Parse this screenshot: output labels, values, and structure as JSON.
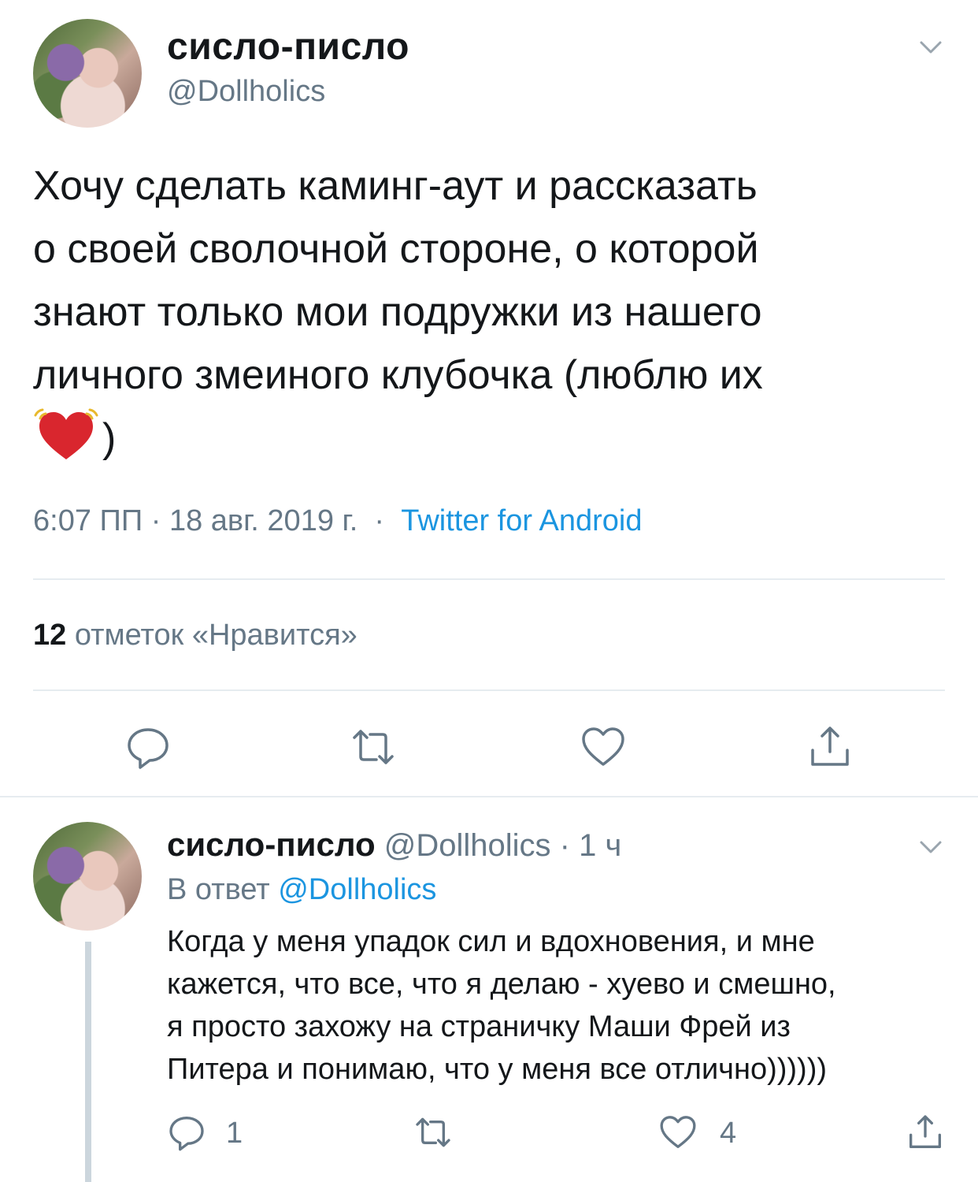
{
  "main_tweet": {
    "display_name": "сисло-писло",
    "handle": "@Dollhoics",
    "text_lines": [
      "Хочу сделать каминг-аут и рассказать",
      "о своей сволочной стороне, о которой",
      "знают только мои подружки из нашего",
      "личного змеиного клубочка (люблю их",
      ")"
    ],
    "time": "6:07 ПП",
    "date": "18 авг. 2019 г.",
    "separator": "·",
    "source": "Twitter for Android",
    "likes_count": "12",
    "likes_label": "отметок «Нравится»",
    "emoji": "vibrating-heart"
  },
  "reply_tweet": {
    "display_name": "сисло-писло",
    "handle": "@Dollholics",
    "time_ago": "· 1 ч",
    "reply_prefix": "В ответ",
    "reply_mention": "@Dollholics",
    "text_lines": [
      "Когда у меня упадок сил и вдохновения, и мне",
      "кажется, что все, что я делаю - хуево и смешно,",
      "я просто захожу на страничку Маши Фрей из",
      "Питера и понимаю, что у меня все отлично))))))"
    ],
    "reply_count": "1",
    "like_count": "4"
  },
  "colors": {
    "text": "#14171a",
    "secondary": "#657786",
    "link": "#1b95e0",
    "divider": "#e6ecf0"
  }
}
